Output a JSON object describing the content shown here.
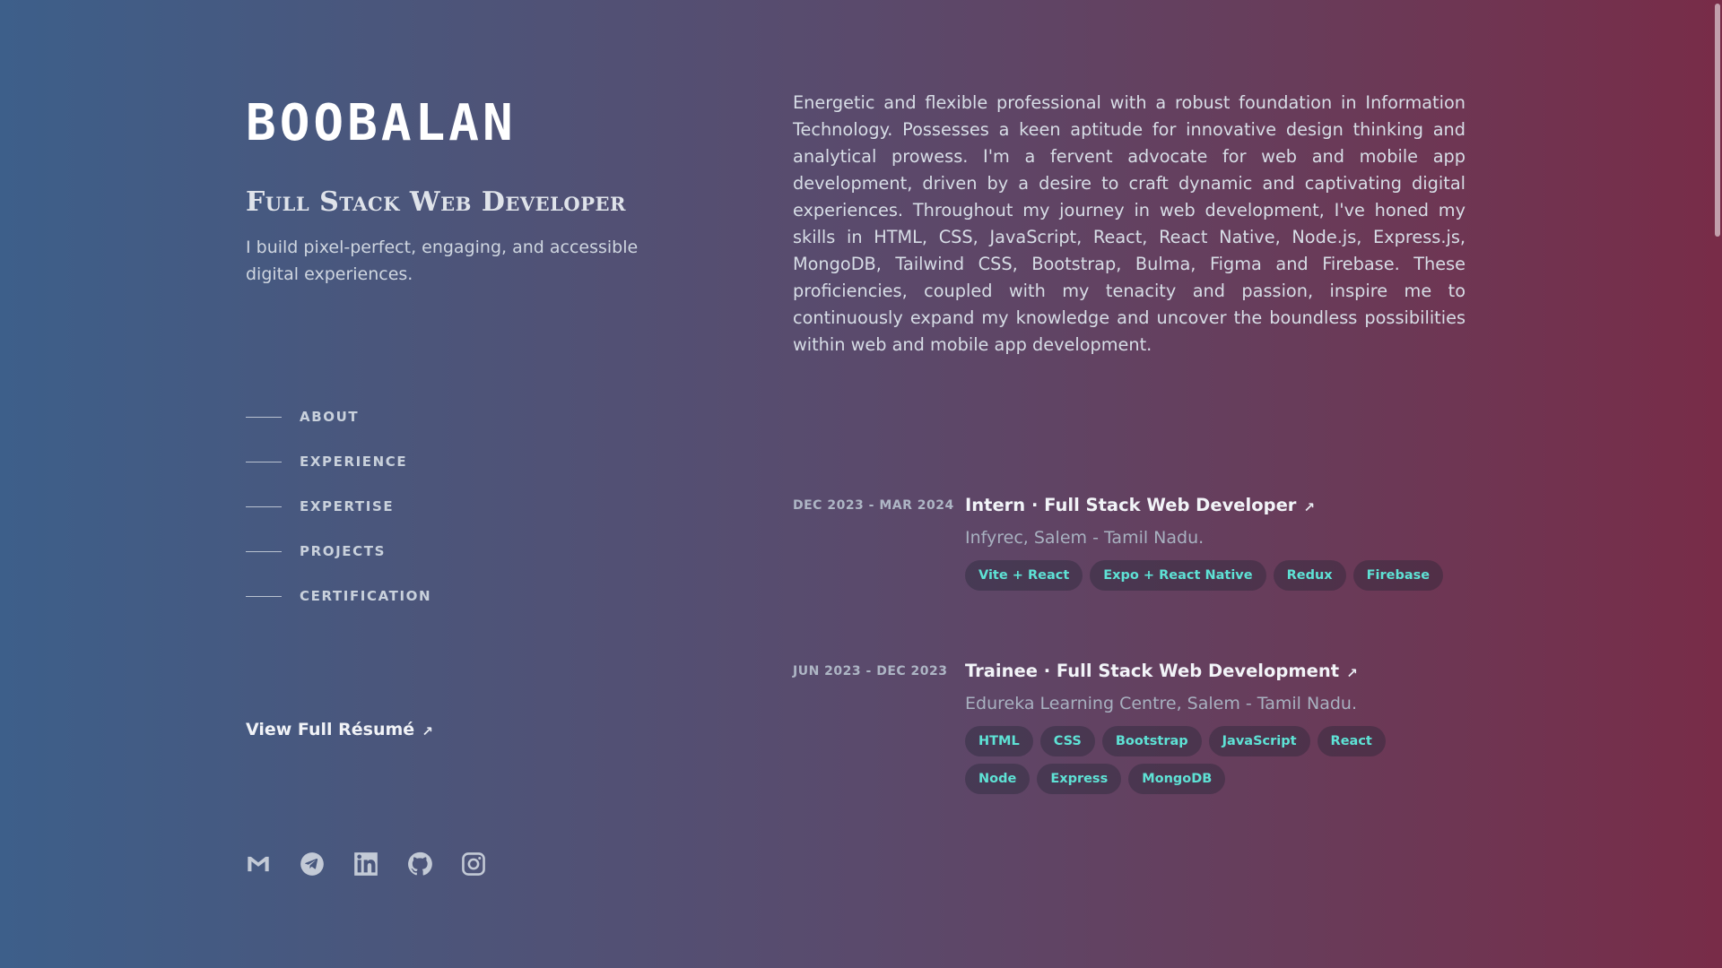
{
  "profile": {
    "name": "BOOBALAN",
    "title": "Full Stack Web Developer",
    "tagline": "I build pixel-perfect, engaging, and accessible digital experiences."
  },
  "nav": [
    {
      "label": "ABOUT"
    },
    {
      "label": "EXPERIENCE"
    },
    {
      "label": "EXPERTISE"
    },
    {
      "label": "PROJECTS"
    },
    {
      "label": "CERTIFICATION"
    }
  ],
  "resume_link": "View Full Résumé",
  "socials": [
    "gmail-icon",
    "telegram-icon",
    "linkedin-icon",
    "github-icon",
    "instagram-icon"
  ],
  "about": "Energetic and flexible professional with a robust foundation in Information Technology. Possesses a keen aptitude for innovative design thinking and analytical prowess. I'm a fervent advocate for web and mobile app development, driven by a desire to craft dynamic and captivating digital experiences. Throughout my journey in web development, I've honed my skills in HTML, CSS, JavaScript, React, React Native, Node.js, Express.js, MongoDB, Tailwind CSS, Bootstrap, Bulma, Figma and Firebase. These proficiencies, coupled with my tenacity and passion, inspire me to continuously expand my knowledge and uncover the boundless possibilities within web and mobile app development.",
  "experience": [
    {
      "date": "DEC 2023 - MAR 2024",
      "title": "Intern · Full Stack Web Developer",
      "company": "Infyrec, Salem - Tamil Nadu.",
      "tags": [
        "Vite + React",
        "Expo + React Native",
        "Redux",
        "Firebase"
      ]
    },
    {
      "date": "JUN 2023 - DEC 2023",
      "title": "Trainee · Full Stack Web Development",
      "company": "Edureka Learning Centre, Salem - Tamil Nadu.",
      "tags": [
        "HTML",
        "CSS",
        "Bootstrap",
        "JavaScript",
        "React",
        "Node",
        "Express",
        "MongoDB"
      ]
    }
  ],
  "colors": {
    "accent": "#5ee2d5",
    "gradient_left": "#3d5f8a",
    "gradient_right": "#782c48"
  }
}
